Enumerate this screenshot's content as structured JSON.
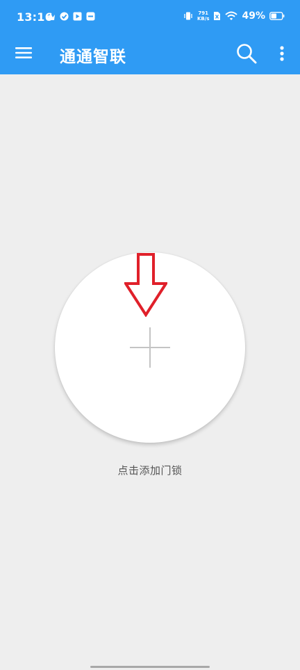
{
  "status_bar": {
    "time": "13:16",
    "net_speed_value": "791",
    "net_speed_unit": "KB/s",
    "battery_percent": "49%"
  },
  "app_bar": {
    "title": "通通智联",
    "background_color": "#2f9bf4",
    "icons": [
      "menu-icon",
      "search-icon",
      "more-vert-icon"
    ]
  },
  "main": {
    "add_button_icon": "plus-icon",
    "add_lock_label": "点击添加门锁",
    "annotation_color": "#e0202a"
  }
}
